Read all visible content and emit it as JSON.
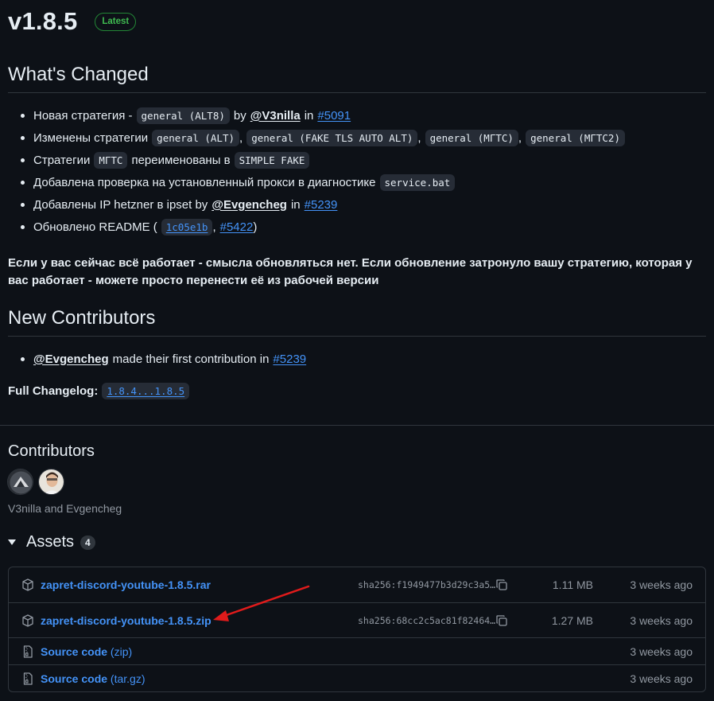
{
  "release": {
    "version": "v1.8.5",
    "badge": "Latest"
  },
  "whats_changed": {
    "title": "What's Changed",
    "items": [
      {
        "text": "Новая стратегия -",
        "code": "general (ALT8)",
        "by": "by",
        "author": "@V3nilla",
        "in": "in",
        "pr": "#5091"
      },
      {
        "text": "Изменены стратегии",
        "codes": [
          "general (ALT)",
          "general (FAKE TLS AUTO ALT)",
          "general (МГТС)",
          "general (МГТС2)"
        ],
        "sep": ","
      },
      {
        "text1": "Стратегии",
        "code1": "МГТС",
        "text2": "переименованы в",
        "code2": "SIMPLE FAKE"
      },
      {
        "text": "Добавлена проверка на установленный прокси в диагностике",
        "code": "service.bat"
      },
      {
        "text": "Добавлены IP hetzner в ipset by",
        "author": "@Evgencheg",
        "in": "in",
        "pr": "#5239"
      },
      {
        "text": "Обновлено README (",
        "commit": "1c05e1b",
        "sep": ",",
        "pr": "#5422",
        "close": ")"
      }
    ]
  },
  "note": "Если у вас сейчас всё работает - смысла обновляться нет. Если обновление затронуло вашу стратегию, которая у вас работает - можете просто перенести её из рабочей версии",
  "new_contributors": {
    "title": "New Contributors",
    "author": "@Evgencheg",
    "text": "made their first contribution in",
    "pr": "#5239"
  },
  "changelog": {
    "label": "Full Changelog:",
    "range": "1.8.4...1.8.5"
  },
  "contributors": {
    "title": "Contributors",
    "names": "V3nilla and Evgencheg"
  },
  "assets": {
    "title": "Assets",
    "count": "4",
    "rows": [
      {
        "name": "zapret-discord-youtube-1.8.5.rar",
        "sha": "sha256:f1949477b3d29c3a5…",
        "size": "1.11 MB",
        "date": "3 weeks ago",
        "icon": "package-icon"
      },
      {
        "name": "zapret-discord-youtube-1.8.5.zip",
        "sha": "sha256:68cc2c5ac81f82464…",
        "size": "1.27 MB",
        "date": "3 weeks ago",
        "icon": "package-icon"
      },
      {
        "name": "Source code",
        "ext": "(zip)",
        "date": "3 weeks ago",
        "icon": "file-zip-icon"
      },
      {
        "name": "Source code",
        "ext": "(tar.gz)",
        "date": "3 weeks ago",
        "icon": "file-zip-icon"
      }
    ]
  },
  "colors": {
    "background": "#0d1117",
    "link": "#4493f8",
    "latest": "#3fb950",
    "annotation_arrow": "#e01b1b"
  }
}
